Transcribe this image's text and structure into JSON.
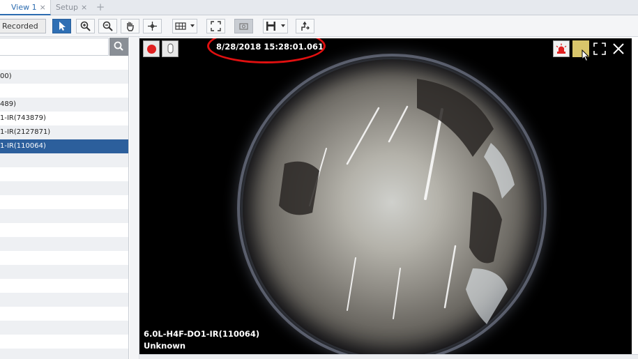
{
  "tabs": [
    {
      "label": "View 1",
      "close": "×"
    },
    {
      "label": "Setup",
      "close": "×"
    }
  ],
  "tab_add": "+",
  "toolbar": {
    "recorded_label": "Recorded",
    "tools": [
      "select-pointer-icon",
      "zoom-in-icon",
      "zoom-out-icon",
      "pan-hand-icon",
      "move-icon",
      "layout-icon",
      "fullscreen-icon",
      "snapshot-icon",
      "save-icon",
      "export-icon"
    ]
  },
  "camera_list": {
    "rows": [
      "00)",
      "",
      "489)",
      "1-IR(743879)",
      "1-IR(2127871)",
      "1-IR(110064)",
      "",
      "",
      "",
      "",
      "",
      "",
      "",
      "",
      "",
      "",
      "",
      "",
      "",
      "",
      ""
    ],
    "selected_index": 5
  },
  "video": {
    "timestamp": "8/28/2018 15:28:01.061",
    "camera_name": "6.0L-H4F-DO1-IR(110064)",
    "status": "Unknown"
  },
  "colors": {
    "accent": "#2c5f9c",
    "highlight_ring": "#e01010",
    "record": "#e02020"
  }
}
